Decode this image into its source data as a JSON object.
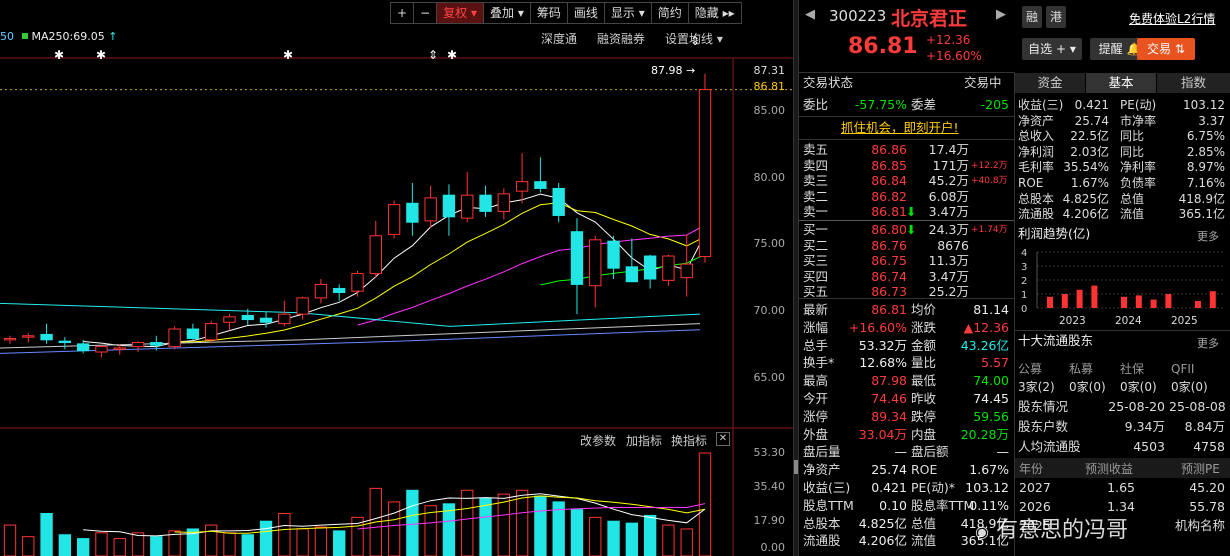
{
  "toolbar": {
    "plus": "+",
    "minus": "−",
    "fuquan": "复权",
    "diejia": "叠加",
    "chouma": "筹码",
    "huaxian": "画线",
    "xianshi": "显示",
    "jianyue": "简约",
    "yincang": "隐藏"
  },
  "ma_text": {
    "prefix": "50",
    "ma250": "MA250:69.05",
    "arrow": "↑"
  },
  "chart_buttons": {
    "shendu": "深度通",
    "rongzi": "融资融券",
    "shezhi": "设置均线"
  },
  "price_axis": [
    "87.31",
    "86.81",
    "85.00",
    "80.00",
    "75.00",
    "70.00",
    "65.00"
  ],
  "peak_label": "87.98",
  "vol_buttons": {
    "gai": "改参数",
    "jia": "加指标",
    "huan": "换指标",
    "close": "✕"
  },
  "vol_axis": [
    "53.30",
    "35.40",
    "17.90",
    "0.00"
  ],
  "stock": {
    "code": "300223",
    "name": "北京君正",
    "price": "86.81",
    "change": "+12.36",
    "pct": "+16.60%",
    "rong": "融",
    "gang": "港",
    "l2": "免费体验L2行情"
  },
  "buttons": {
    "zixuan": "自选",
    "tixing": "提醒",
    "jiaoyi": "交易"
  },
  "status": {
    "label": "交易状态",
    "value": "交易中"
  },
  "weibi": {
    "l1": "委比",
    "v1": "-57.75%",
    "l2": "委差",
    "v2": "-205"
  },
  "promo": "抓住机会，即刻开户!",
  "asks": [
    {
      "l": "卖五",
      "p": "86.86",
      "v": "17.4万",
      "d": ""
    },
    {
      "l": "卖四",
      "p": "86.85",
      "v": "171万",
      "d": "+12.2万"
    },
    {
      "l": "卖三",
      "p": "86.84",
      "v": "45.2万",
      "d": "+40.8万"
    },
    {
      "l": "卖二",
      "p": "86.82",
      "v": "6.08万",
      "d": ""
    },
    {
      "l": "卖一",
      "p": "86.81",
      "v": "3.47万",
      "d": ""
    }
  ],
  "bids": [
    {
      "l": "买一",
      "p": "86.80",
      "v": "24.3万",
      "d": "+1.74万"
    },
    {
      "l": "买二",
      "p": "86.76",
      "v": "8676",
      "d": ""
    },
    {
      "l": "买三",
      "p": "86.75",
      "v": "11.3万",
      "d": ""
    },
    {
      "l": "买四",
      "p": "86.74",
      "v": "3.47万",
      "d": ""
    },
    {
      "l": "买五",
      "p": "86.73",
      "v": "25.2万",
      "d": ""
    }
  ],
  "quote": [
    {
      "l1": "最新",
      "v1": "86.81",
      "l2": "均价",
      "v2": "81.14"
    },
    {
      "l1": "涨幅",
      "v1": "+16.60%",
      "l2": "涨跌",
      "v2": "▲12.36"
    },
    {
      "l1": "总手",
      "v1": "53.32万",
      "l2": "金额",
      "v2": "43.26亿"
    },
    {
      "l1": "换手*",
      "v1": "12.68%",
      "l2": "量比",
      "v2": "5.57"
    },
    {
      "l1": "最高",
      "v1": "87.98",
      "l2": "最低",
      "v2": "74.00"
    },
    {
      "l1": "今开",
      "v1": "74.46",
      "l2": "昨收",
      "v2": "74.45"
    },
    {
      "l1": "涨停",
      "v1": "89.34",
      "l2": "跌停",
      "v2": "59.56"
    },
    {
      "l1": "外盘",
      "v1": "33.04万",
      "l2": "内盘",
      "v2": "20.28万"
    },
    {
      "l1": "盘后量",
      "v1": "—",
      "l2": "盘后额",
      "v2": "—"
    },
    {
      "l1": "净资产",
      "v1": "25.74",
      "l2": "ROE",
      "v2": "1.67%"
    },
    {
      "l1": "收益(三)",
      "v1": "0.421",
      "l2": "PE(动)*",
      "v2": "103.12"
    },
    {
      "l1": "股息TTM",
      "v1": "0.10",
      "l2": "股息率TTM",
      "v2": "0.11%"
    },
    {
      "l1": "总股本",
      "v1": "4.825亿",
      "l2": "总值",
      "v2": "418.9亿"
    },
    {
      "l1": "流通股",
      "v1": "4.206亿",
      "l2": "流值",
      "v2": "365.1亿"
    }
  ],
  "tabs": {
    "t1": "资金",
    "t2": "基本",
    "t3": "指数"
  },
  "basic": [
    {
      "l1": "收益(三)",
      "v1": "0.421",
      "l2": "PE(动)",
      "v2": "103.12"
    },
    {
      "l1": "净资产",
      "v1": "25.74",
      "l2": "市净率",
      "v2": "3.37"
    },
    {
      "l1": "总收入",
      "v1": "22.5亿",
      "l2": "同比",
      "v2": "6.75%"
    },
    {
      "l1": "净利润",
      "v1": "2.03亿",
      "l2": "同比",
      "v2": "2.85%"
    },
    {
      "l1": "毛利率",
      "v1": "35.54%",
      "l2": "净利率",
      "v2": "8.97%"
    },
    {
      "l1": "ROE",
      "v1": "1.67%",
      "l2": "负债率",
      "v2": "7.16%"
    },
    {
      "l1": "总股本",
      "v1": "4.825亿",
      "l2": "总值",
      "v2": "418.9亿"
    },
    {
      "l1": "流通股",
      "v1": "4.206亿",
      "l2": "流值",
      "v2": "365.1亿"
    }
  ],
  "profit": {
    "title": "利润趋势(亿)",
    "more": "更多",
    "yticks": [
      "4",
      "3",
      "2",
      "1",
      "0"
    ],
    "years": [
      "2023",
      "2024",
      "2025"
    ],
    "values": [
      0.8,
      1.0,
      1.3,
      1.6,
      0,
      0.8,
      0.9,
      0.6,
      1.0,
      0,
      0.5,
      1.2
    ]
  },
  "holders": {
    "title": "十大流通股东",
    "more": "更多",
    "cats": [
      "公募",
      "私募",
      "社保",
      "QFII"
    ],
    "vals": [
      "3家(2)",
      "0家(0)",
      "0家(0)",
      "0家(0)"
    ]
  },
  "holder_info": [
    {
      "l": "股东情况",
      "a": "25-08-20",
      "b": "25-08-08"
    },
    {
      "l": "股东户数",
      "a": "9.34万",
      "b": "8.84万"
    },
    {
      "l": "人均流通股",
      "a": "4503",
      "b": "4758"
    }
  ],
  "forecast": {
    "h1": "年份",
    "h2": "预测收益",
    "h3": "预测PE",
    "rows": [
      [
        "2027",
        "1.65",
        "45.20"
      ],
      [
        "2026",
        "1.34",
        "55.78"
      ],
      [
        "2025",
        "",
        "机构名称"
      ]
    ]
  },
  "watermark": "有意思的冯哥",
  "chart_data": {
    "type": "candlestick",
    "ylim": [
      62,
      89
    ],
    "candles": [
      [
        68.3,
        68.6,
        68.0,
        68.4
      ],
      [
        68.5,
        68.8,
        68.1,
        68.6
      ],
      [
        68.7,
        69.5,
        68.0,
        68.3
      ],
      [
        68.2,
        68.5,
        67.6,
        68.1
      ],
      [
        68.0,
        68.3,
        67.3,
        67.5
      ],
      [
        67.4,
        67.9,
        67.0,
        67.8
      ],
      [
        67.6,
        68.0,
        67.2,
        67.7
      ],
      [
        67.8,
        68.2,
        67.4,
        68.1
      ],
      [
        68.1,
        68.6,
        67.5,
        67.9
      ],
      [
        67.8,
        69.3,
        67.6,
        69.1
      ],
      [
        69.1,
        69.5,
        68.3,
        68.4
      ],
      [
        68.3,
        69.7,
        68.1,
        69.5
      ],
      [
        69.6,
        70.2,
        69.0,
        70.0
      ],
      [
        70.1,
        70.6,
        69.4,
        69.8
      ],
      [
        69.9,
        70.4,
        69.2,
        69.6
      ],
      [
        69.5,
        71.2,
        69.3,
        70.2
      ],
      [
        70.2,
        71.5,
        69.8,
        71.4
      ],
      [
        71.4,
        72.8,
        71.0,
        72.4
      ],
      [
        72.1,
        72.4,
        71.2,
        71.8
      ],
      [
        71.9,
        73.4,
        71.5,
        73.2
      ],
      [
        73.2,
        77.1,
        72.9,
        76.0
      ],
      [
        76.1,
        78.6,
        75.8,
        78.3
      ],
      [
        78.4,
        79.9,
        76.0,
        77.0
      ],
      [
        77.1,
        79.7,
        76.6,
        78.8
      ],
      [
        79.0,
        79.8,
        76.0,
        77.4
      ],
      [
        77.3,
        80.7,
        77.0,
        79.0
      ],
      [
        79.0,
        79.7,
        77.4,
        77.8
      ],
      [
        77.8,
        79.5,
        77.2,
        79.1
      ],
      [
        79.3,
        82.1,
        78.4,
        80.0
      ],
      [
        80.0,
        81.8,
        79.2,
        79.5
      ],
      [
        79.5,
        79.9,
        77.0,
        77.5
      ],
      [
        76.3,
        77.3,
        70.2,
        72.4
      ],
      [
        72.3,
        76.0,
        70.7,
        75.7
      ],
      [
        75.6,
        76.0,
        72.8,
        73.6
      ],
      [
        73.7,
        75.8,
        72.6,
        72.6
      ],
      [
        74.5,
        74.6,
        72.1,
        72.8
      ],
      [
        72.7,
        74.6,
        72.3,
        74.5
      ],
      [
        72.9,
        76.1,
        71.5,
        73.9
      ],
      [
        74.46,
        87.98,
        74.0,
        86.81
      ]
    ],
    "volume": [
      16,
      10,
      22,
      11,
      9,
      12,
      9,
      12,
      10,
      13,
      14,
      16,
      12,
      11,
      18,
      22,
      14,
      15,
      13,
      20,
      35,
      28,
      34,
      26,
      27,
      34,
      30,
      32,
      34,
      31,
      28,
      24,
      20,
      18,
      17,
      21,
      16,
      14,
      53.3
    ],
    "vol_ylim": [
      0,
      53.3
    ]
  }
}
